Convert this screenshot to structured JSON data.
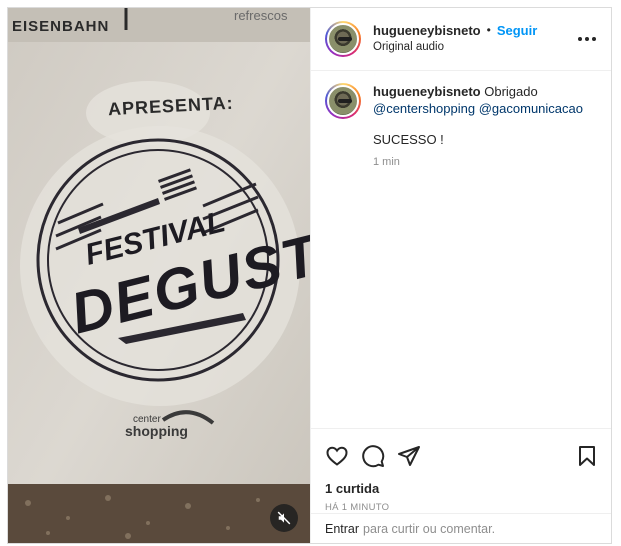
{
  "media": {
    "bag_top_left": "EISENBAHN",
    "bag_top_right": "refrescos",
    "presents": "APRESENTA:",
    "festival": "FESTIVAL",
    "degusta": "DEGUSTA",
    "mall_logo_top": "center",
    "mall_logo_bottom": "shopping",
    "mute_icon": "speaker-muted-icon"
  },
  "header": {
    "username": "hugueneybisneto",
    "separator": "•",
    "follow_label": "Seguir",
    "audio_label": "Original audio",
    "more_icon": "more-horizontal-icon"
  },
  "caption": {
    "username": "hugueneybisneto",
    "text": "Obrigado",
    "mention1": "@centershopping",
    "mention2": "@gacomunicacao",
    "extra": "SUCESSO !",
    "time": "1 min"
  },
  "actions": {
    "icons": [
      "heart-icon",
      "comment-icon",
      "share-icon",
      "bookmark-icon"
    ],
    "likes": "1 curtida",
    "posted_ago": "HÁ 1 MINUTO"
  },
  "comment_box": {
    "login_link": "Entrar",
    "text": "para curtir ou comentar."
  }
}
